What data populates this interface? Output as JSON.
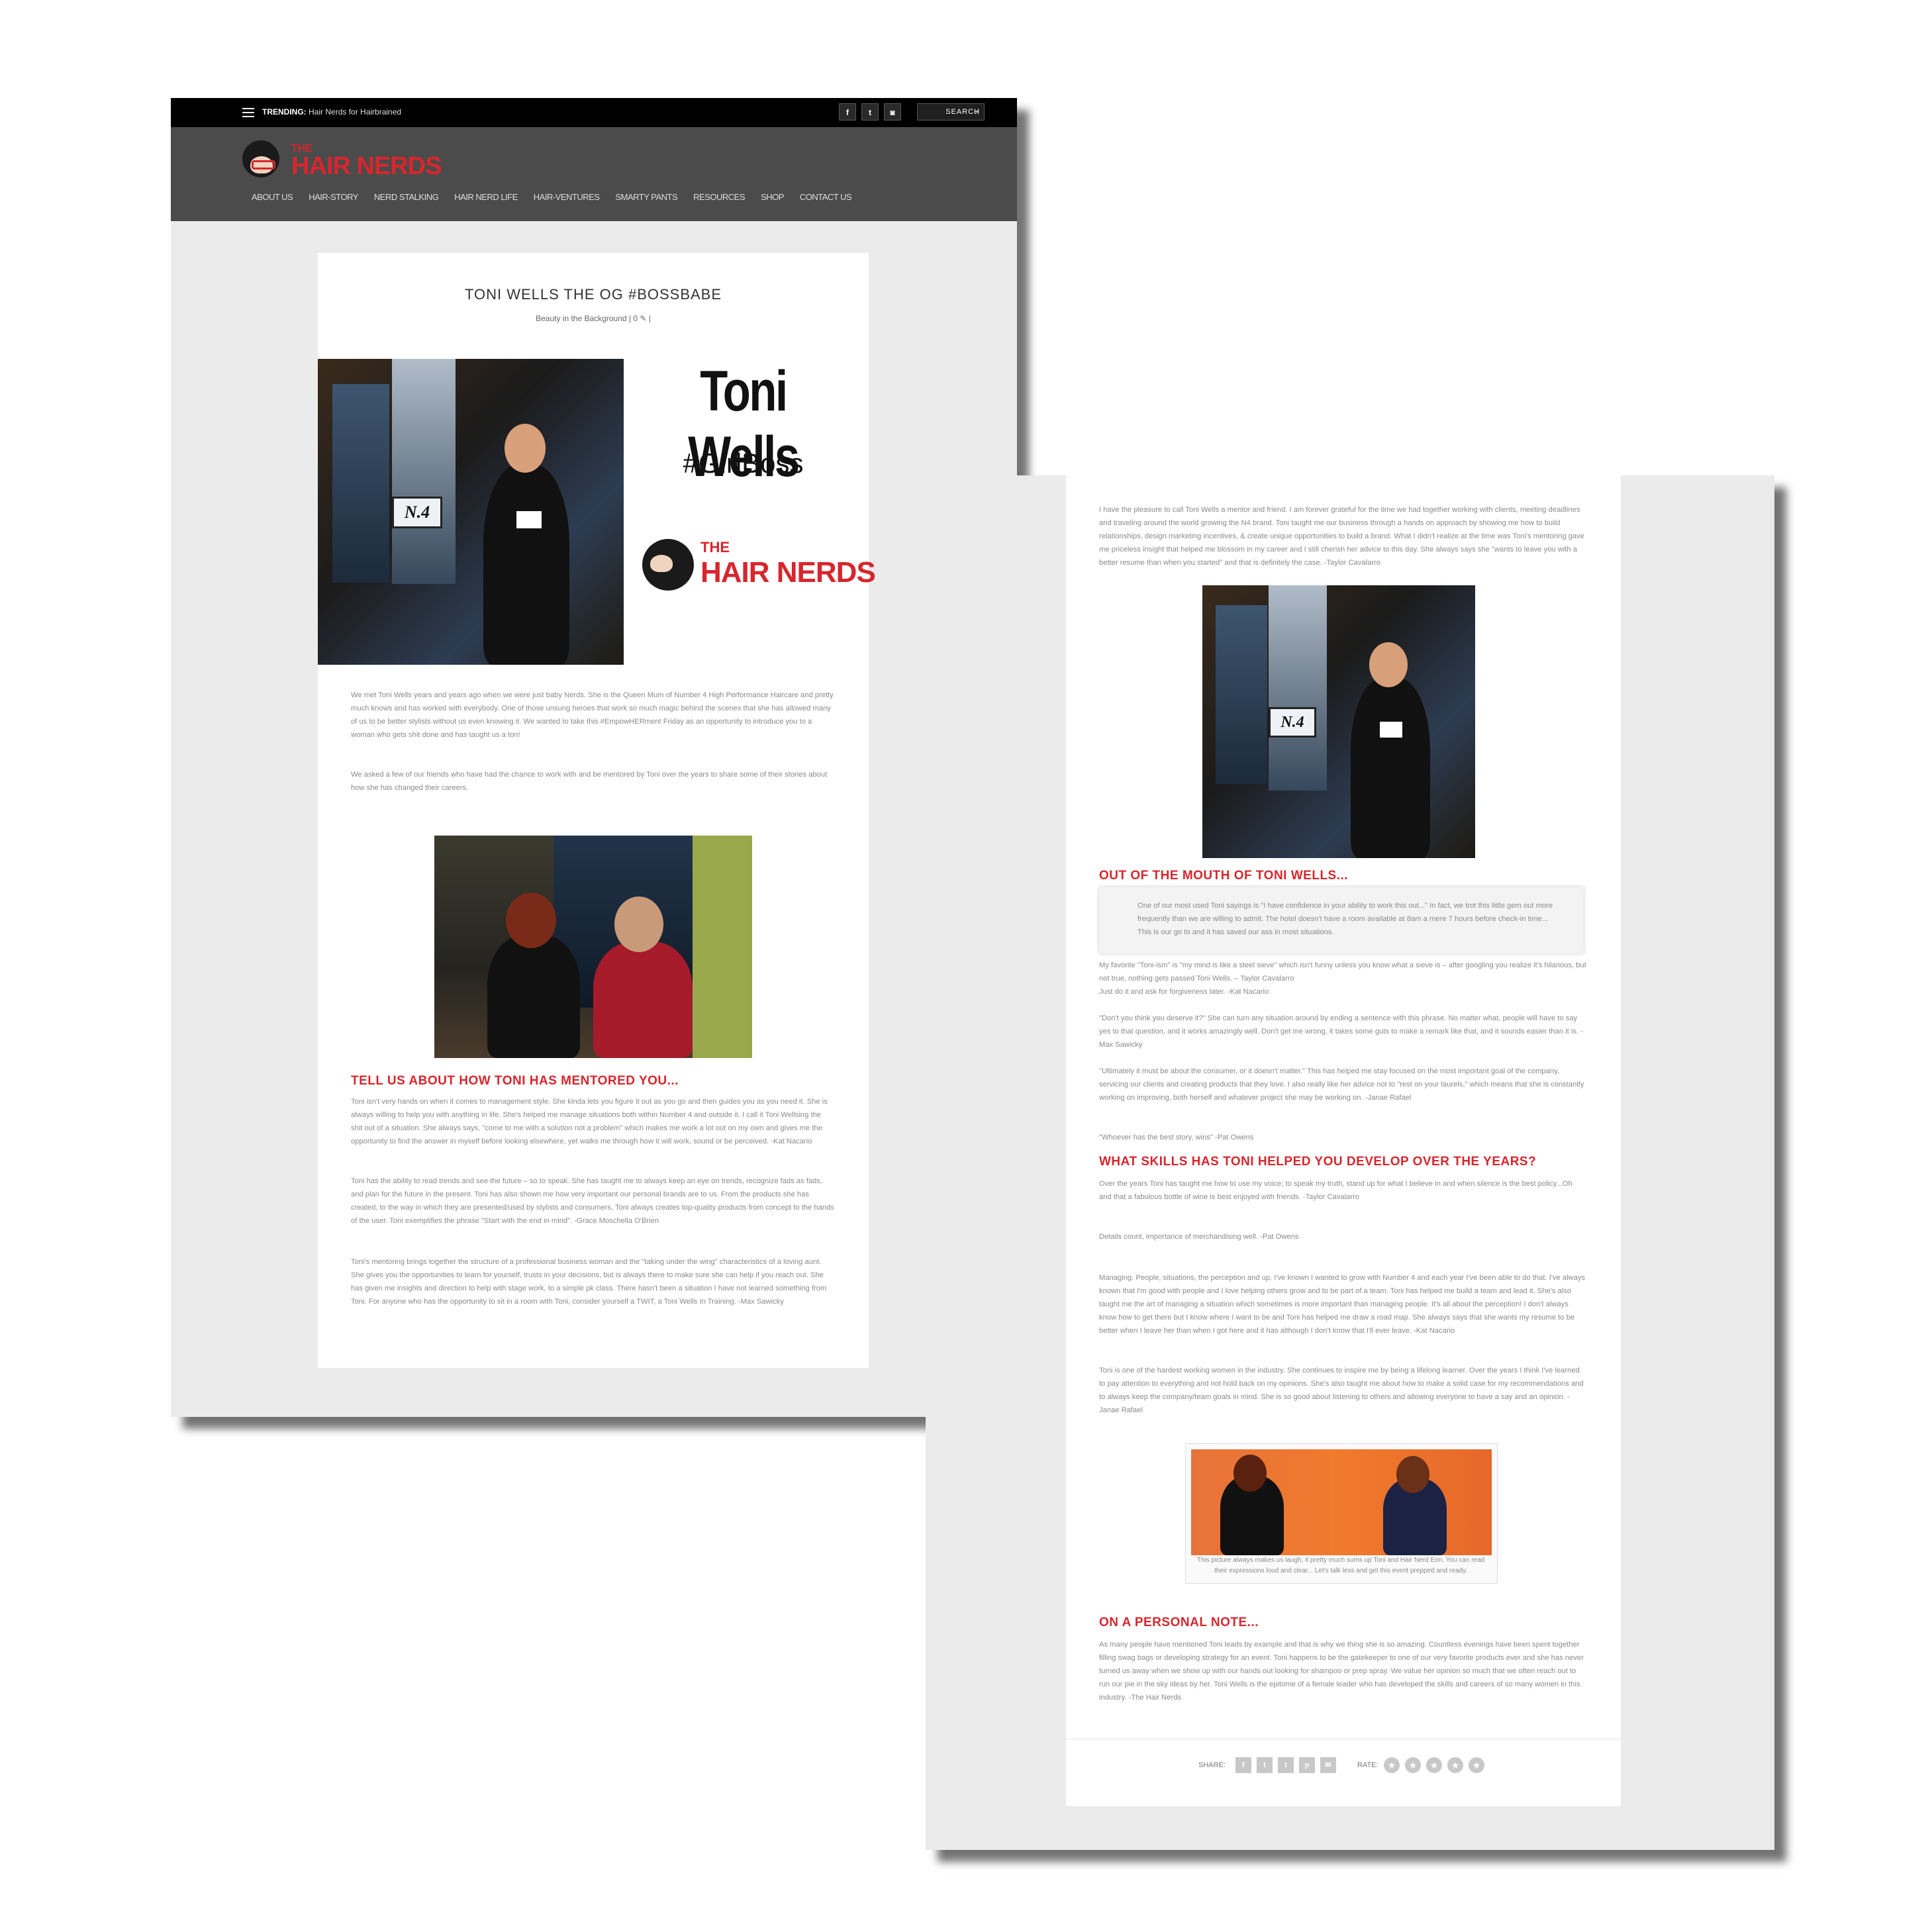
{
  "topbar": {
    "trending_label": "TRENDING:",
    "trending_text": "Hair Nerds for Hairbrained",
    "social_icons": [
      "facebook-icon",
      "twitter-icon",
      "instagram-icon",
      "youtube-icon"
    ],
    "search_placeholder": "SEARCH"
  },
  "brand": {
    "logo_the": "THE",
    "logo_name": "HAIR NERDS",
    "accent": "#d7262d"
  },
  "nav": [
    "ABOUT US",
    "HAIR-STORY",
    "NERD STALKING",
    "HAIR NERD LIFE",
    "HAIR-VENTURES",
    "SMARTY PANTS",
    "RESOURCES",
    "SHOP",
    "CONTACT US"
  ],
  "article": {
    "title": "TONI WELLS THE OG #BOSSBABE",
    "category": "Beauty in the Background",
    "comments": "0",
    "promo_name": "Toni Wells",
    "promo_tag": "#GirlBoss",
    "photo_sign": "N.4",
    "photo_brand": "Number 4 High Performance Hair Care",
    "intro_1": "We met Toni Wells years and years ago when we were just baby Nerds. She is the Queen Mum of Number 4 High Performance Haircare and pretty much knows and has worked with everybody. One of those unsung heroes that work so much magic behind the scenes that she has allowed many of us to be better stylists without us even knowing it. We wanted to take this #EmpowHERment Friday as an opportunity to introduce you to a woman who gets shit done and has taught us a ton!",
    "intro_2": "We asked a few of our friends who have had the chance to work with and be mentored by Toni over the years to share some of their stories about how she has changed their careers.",
    "heading_1": "TELL US ABOUT HOW TONI HAS MENTORED YOU...",
    "mentor_1": "Toni isn't very hands on when it comes to management style. She kinda lets you figure it out as you go and then guides you as you need it. She is always willing to help you with anything in life. She's helped me manage situations both within Number 4 and outside it. I call it Toni Wellsing the shit out of a situation. She always says, \"come to me with a solution not a problem\" which makes me work a lot out on my own and gives me the opportunity to find the answer in myself before looking elsewhere, yet walks me through how it will work, sound or be perceived. -Kat Nacario",
    "mentor_2": "Toni has the ability to read trends and see the future – so to speak. She has taught me to always keep an eye on trends, recognize fads as fads, and plan for the future in the present. Toni has also shown me how very important our personal brands are to us. From the products she has created, to the way in which they are presented/used by stylists and consumers, Toni always creates top-quality products from concept to the hands of the user. Toni exemplifies the phrase \"Start with the end in mind\". -Grace Moschella O'Brien",
    "mentor_3": "Toni's mentoring brings together the structure of a professional business woman and the \"taking under the wing\" characteristics of a loving aunt. She gives you the opportunities to learn for yourself, trusts in your decisions, but is always there to make sure she can help if you reach out. She has given me insights and direction to help with stage work, to a simple pk class. There hasn't been a situation I have not learned something from Toni. For anyone who has the opportunity to sit in a room with Toni, consider yourself a TWIT, a Toni Wells In Training. -Max Sawicky"
  },
  "page2": {
    "intro": "I have the pleasure to call Toni Wells a mentor and friend. I am forever grateful for the time we had together working with clients, meeting deadlines and traveling around the world growing the N4 brand. Toni taught me our business through a hands on approach by showing me how to build relationships, design marketing incentives, & create unique opportunities to build a brand. What I didn't realize at the time was Toni's mentoring gave me priceless insight that helped me blossom in my career and I still cherish her advice to this day. She always says she \"wants to leave you with a better resume than when you started\" and that is definitely the case. -Taylor Cavalarro",
    "heading_2": "OUT OF THE MOUTH OF TONI WELLS...",
    "quote": "One of our most used Toni sayings is \"I have confidence in your ability to work this out...\" In fact, we trot this little gem out more frequently than we are willing to admit. The hotel doesn't have a room available at 8am a mere 7 hours before check-in time... This is our go to and it has saved our ass in most situations.",
    "saying_1": "My favorite \"Toni-ism\" is \"my mind is like a steel sieve\" which isn't funny unless you know what a sieve is – after googling you realize it's hilarious, but not true, nothing gets passed Toni Wells. – Taylor Cavalarro",
    "saying_1b": "Just do it and ask for forgiveness later. -Kat Nacario",
    "saying_2": "\"Don't you think you deserve it?\" She can turn any situation around by ending a sentence with this phrase. No matter what, people will have to say yes to that question, and it works amazingly well. Don't get me wrong, it takes some guts to make a remark like that, and it sounds easier than it is. -Max Sawicky",
    "saying_3": "\"Ultimately it must be about the consumer, or it doesn't matter.\" This has helped me stay focused on the most important goal of the company, servicing our clients and creating products that they love. I also really like her advice not to \"rest on your laurels,\" which means that she is constantly working on improving, both herself and whatever project she may be working on. -Janae Rafael",
    "saying_4": "\"Whoever has the best story, wins\" -Pat Owens",
    "heading_3": "WHAT SKILLS HAS TONI HELPED YOU DEVELOP OVER THE YEARS?",
    "skill_1": "Over the years Toni has taught me how to use my voice; to speak my truth, stand up for what I believe in and when silence is the best policy...Oh and that a fabulous bottle of wine is best enjoyed with friends. -Taylor Cavalarro",
    "skill_2": "Details count, importance of merchandising well. -Pat Owens",
    "skill_3": "Managing. People, situations, the perception and up. I've known I wanted to grow with Number 4 and each year I've been able to do that. I've always known that I'm good with people and I love helping others grow and to be part of a team. Toni has helped me build a team and lead it. She's also taught me the art of managing a situation which sometimes is more important than managing people. It's all about the perception! I don't always know how to get there but I know where I want to be and Toni has helped me draw a road map. She always says that she wants my resume to be better when I leave her than when I got here and it has although I don't know that I'll ever leave. -Kat Nacario",
    "skill_4": "Toni is one of the hardest working women in the industry. She continues to inspire me by being a lifelong learner. Over the years I think I've learned to pay attention to everything and not hold back on my opinions. She's also taught me about how to make a solid case for my recommendations and to always keep the company/team goals in mind. She is so good about listening to others and allowing everyone to have a say and an opinion. -Janae Rafael",
    "caption": "This picture always makes us laugh, it pretty much sums up Toni and Hair Nerd Erin. You can read their expressions loud and clear... Let's talk less and get this event prepped and ready.",
    "heading_4": "ON A PERSONAL NOTE...",
    "personal": "As many people have mentioned Toni leads by example and that is why we thing she is so amazing. Countless evenings have been spent together filling swag bags or developing strategy for an event. Toni happens to be the gatekeeper to one of our very favorite products ever and she has never turned us away when we show up with our hands out looking for shampoo or prep spray. We value her opinion so much that we often reach out to run our pie in the sky ideas by her. Toni Wells is the epitome of a female leader who has developed the skills and careers of so many women in this industry. -The Hair Nerds",
    "share_label": "SHARE:",
    "rate_label": "RATE:",
    "share_icons": [
      "facebook-icon",
      "twitter-icon",
      "tumblr-icon",
      "pinterest-icon",
      "email-icon"
    ],
    "rating_stars": 5
  }
}
